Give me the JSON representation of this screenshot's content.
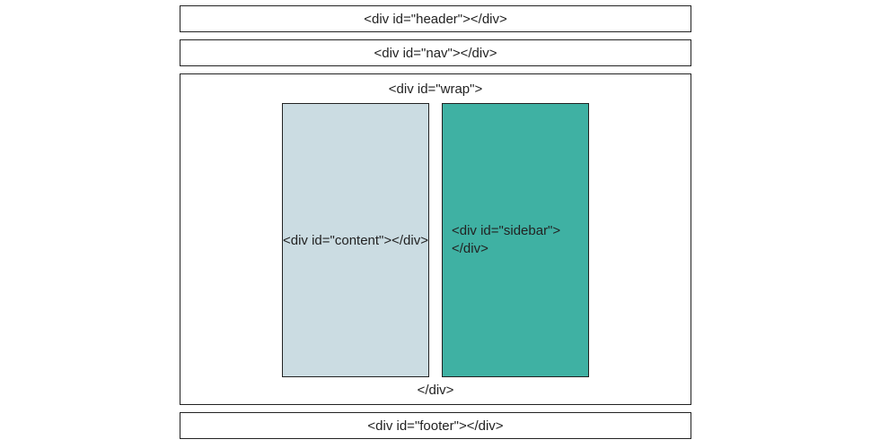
{
  "layout": {
    "header_label": "<div id=\"header\"></div>",
    "nav_label": "<div id=\"nav\"></div>",
    "wrap_open_label": "<div id=\"wrap\">",
    "wrap_close_label": "</div>",
    "content_label": "<div id=\"content\"></div>",
    "sidebar_line1": "<div id=\"sidebar\">",
    "sidebar_line2": "</div>",
    "footer_label": "<div id=\"footer\"></div>"
  },
  "colors": {
    "content_bg": "#cbdce2",
    "sidebar_bg": "#3fb1a3",
    "border": "#222222"
  }
}
